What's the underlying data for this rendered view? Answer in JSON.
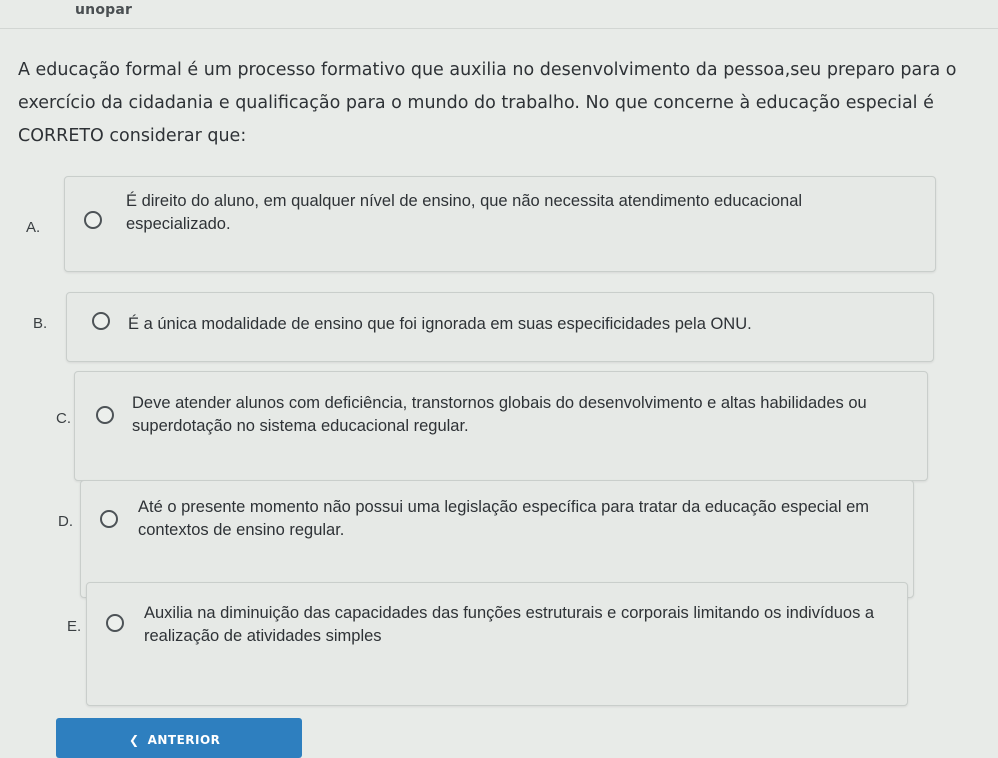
{
  "header": {
    "brand": "unopar"
  },
  "question": {
    "text": "A educação formal é um processo formativo que auxilia no desenvolvimento da pessoa,seu preparo para o exercício da cidadania e qualificação para o mundo do trabalho. No que concerne à educação especial é CORRETO considerar que:"
  },
  "options": [
    {
      "letter": "A.",
      "text": "É direito do aluno, em qualquer nível de ensino, que não necessita atendimento educacional especializado."
    },
    {
      "letter": "B.",
      "text": "É a única modalidade de ensino que foi ignorada em suas especificidades pela ONU."
    },
    {
      "letter": "C.",
      "text": "Deve atender alunos com deficiência, transtornos globais do desenvolvimento e altas habilidades ou superdotação no sistema educacional regular."
    },
    {
      "letter": "D.",
      "text": "Até o presente momento não possui uma legislação específica para tratar da educação especial em contextos de ensino regular."
    },
    {
      "letter": "E.",
      "text": "Auxilia na diminuição das capacidades das funções estruturais e corporais limitando os indivíduos a realização de atividades simples"
    }
  ],
  "navigation": {
    "previous_label": "ANTERIOR",
    "previous_icon": "chevron-left-icon"
  },
  "colors": {
    "button": "#2e7fbf"
  }
}
